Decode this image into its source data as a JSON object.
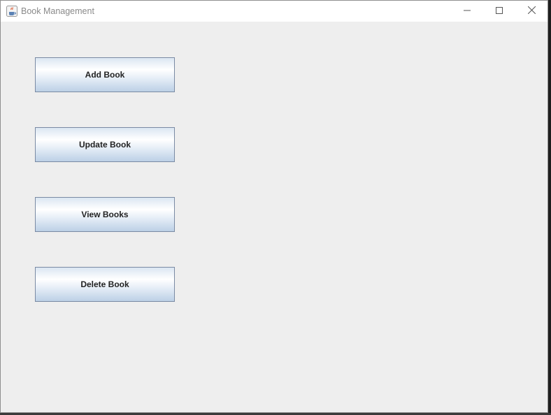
{
  "window": {
    "title": "Book Management",
    "icon": "java-cup-icon",
    "controls": {
      "minimize": "minimize-icon",
      "maximize": "maximize-icon",
      "close": "close-icon"
    }
  },
  "buttons": {
    "add": "Add Book",
    "update": "Update Book",
    "view": "View Books",
    "delete": "Delete Book"
  },
  "colors": {
    "background": "#eeeeee",
    "button_border": "#7a8aa3",
    "button_gradient_top": "#dbe6f2",
    "button_gradient_bottom": "#bcd0e6",
    "title_text": "#8a8a8a"
  }
}
